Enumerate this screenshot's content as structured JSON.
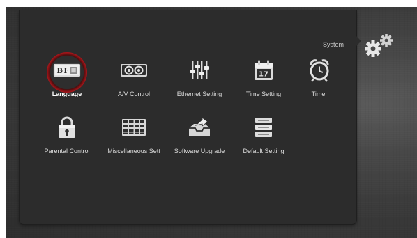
{
  "screen": {
    "title": "System"
  },
  "menu": {
    "items": [
      {
        "label": "Language",
        "icon": "language-icon",
        "selected": true
      },
      {
        "label": "A/V Control",
        "icon": "av-control-icon",
        "selected": false
      },
      {
        "label": "Ethernet Setting",
        "icon": "ethernet-sliders-icon",
        "selected": false
      },
      {
        "label": "Time Setting",
        "icon": "calendar-icon",
        "selected": false
      },
      {
        "label": "Timer",
        "icon": "alarm-clock-icon",
        "selected": false
      },
      {
        "label": "Parental Control",
        "icon": "lock-icon",
        "selected": false
      },
      {
        "label": "Miscellaneous Sett",
        "icon": "grid-icon",
        "selected": false
      },
      {
        "label": "Software Upgrade",
        "icon": "upgrade-tray-icon",
        "selected": false
      },
      {
        "label": "Default Setting",
        "icon": "default-setting-icon",
        "selected": false
      }
    ]
  },
  "calendar": {
    "day": "17"
  },
  "colors": {
    "accent": "#c61d22",
    "panel": "#2c2c2c",
    "background": "#444444",
    "text": "#e8e8e8"
  }
}
